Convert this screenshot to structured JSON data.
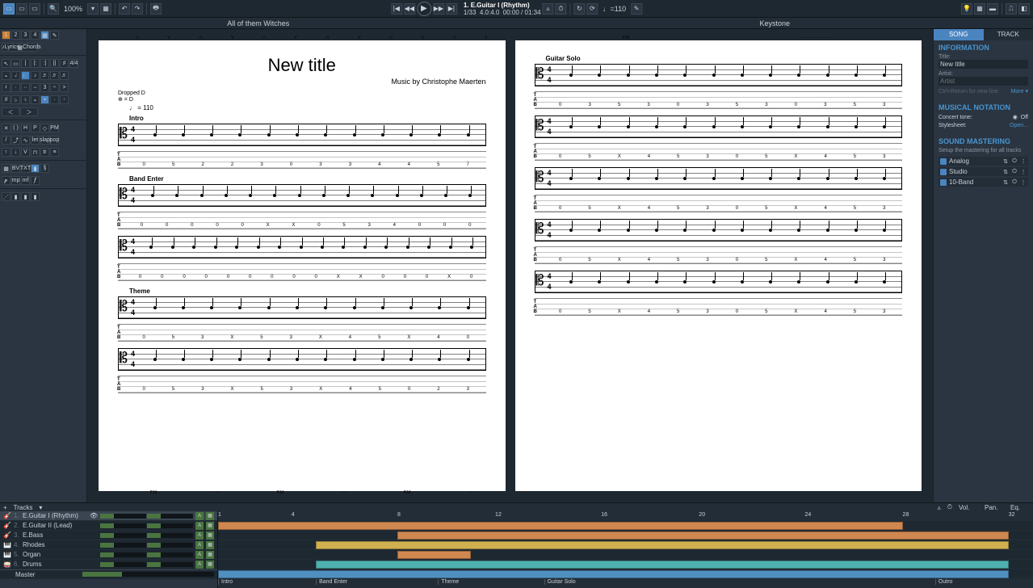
{
  "topbar": {
    "zoom": "100%",
    "track_display": "1. E.Guitar I (Rhythm)",
    "bar_pos": "1/33",
    "time_sig": "4.0:4.0",
    "time": "00:00 / 01:34",
    "tempo_tap": "110"
  },
  "doctabs": {
    "left": "All of them Witches",
    "right": "Keystone"
  },
  "leftpanel": {
    "lyrics": "Lyrics",
    "chords": "Chords",
    "pages": [
      "1",
      "2",
      "3",
      "4"
    ],
    "txt": "TXT"
  },
  "score": {
    "title": "New title",
    "credit": "Music by Christophe Maerten",
    "tuning": "Dropped D",
    "tuning_sym": "⊕ = D",
    "tempo": "♩ = 110",
    "sections": [
      "Intro",
      "Band Enter",
      "Theme",
      "Guitar Solo"
    ],
    "pm": "P.M.",
    "tab_letters": "TAB"
  },
  "rightpanel": {
    "tabs": {
      "song": "SONG",
      "track": "TRACK"
    },
    "info_head": "INFORMATION",
    "title_label": "Title:",
    "title_value": "New title",
    "artist_label": "Artist:",
    "artist_value": "Artist",
    "hint": "Ctrl+Return for new line.",
    "more": "More ▾",
    "notation_head": "MUSICAL NOTATION",
    "concert_tone_label": "Concert tone:",
    "concert_tone_value": "Off",
    "stylesheet_label": "Stylesheet:",
    "stylesheet_value": "Open...",
    "mastering_head": "SOUND MASTERING",
    "mastering_sub": "Setup the mastering for all tracks",
    "effects": [
      {
        "name": "Analog"
      },
      {
        "name": "Studio"
      },
      {
        "name": "10-Band"
      }
    ]
  },
  "tracks": {
    "header": {
      "label": "Tracks",
      "vol": "Vol.",
      "pan": "Pan.",
      "eq": "Eq."
    },
    "ruler": [
      1,
      4,
      8,
      12,
      16,
      20,
      24,
      28,
      32
    ],
    "list": [
      {
        "n": "1.",
        "name": "E.Guitar I (Rhythm)"
      },
      {
        "n": "2.",
        "name": "E.Guitar II (Lead)"
      },
      {
        "n": "3.",
        "name": "E.Bass"
      },
      {
        "n": "4.",
        "name": "Rhodes"
      },
      {
        "n": "5.",
        "name": "Organ"
      },
      {
        "n": "6.",
        "name": "Drums"
      }
    ],
    "master": "Master",
    "markers": [
      "Intro",
      "Band Enter",
      "Theme",
      "Guitar Solo",
      "Outro"
    ]
  },
  "chart_data": null
}
